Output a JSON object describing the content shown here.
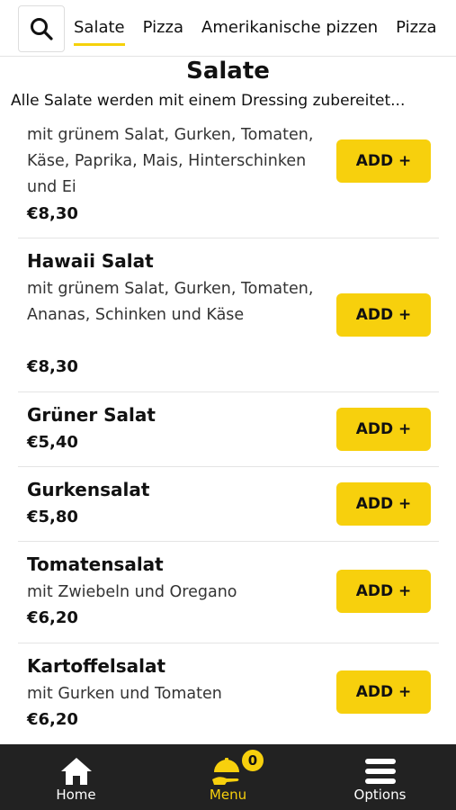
{
  "header": {
    "tabs": [
      {
        "label": "Salate"
      },
      {
        "label": "Pizza"
      },
      {
        "label": "Amerikanische pizzen"
      },
      {
        "label": "Pizza"
      }
    ]
  },
  "category": {
    "title": "Salate",
    "description": "Alle Salate werden mit einem Dressing zubereitet..."
  },
  "items": [
    {
      "name": "",
      "desc": "mit grünem Salat, Gurken, Tomaten, Käse, Paprika, Mais, Hinterschinken und Ei",
      "price": "€8,30",
      "button": "ADD +"
    },
    {
      "name": "Hawaii Salat",
      "desc": "mit grünem Salat, Gurken, Tomaten, Ananas, Schinken und Käse",
      "price": "€8,30",
      "button": "ADD +"
    },
    {
      "name": "Grüner Salat",
      "desc": "",
      "price": "€5,40",
      "button": "ADD +"
    },
    {
      "name": "Gurkensalat",
      "desc": "",
      "price": "€5,80",
      "button": "ADD +"
    },
    {
      "name": "Tomatensalat",
      "desc": "mit Zwiebeln und Oregano",
      "price": "€6,20",
      "button": "ADD +"
    },
    {
      "name": "Kartoffelsalat",
      "desc": "mit Gurken und Tomaten",
      "price": "€6,20",
      "button": "ADD +"
    }
  ],
  "nav": {
    "home": "Home",
    "menu": "Menu",
    "options": "Options",
    "cart_count": "0"
  },
  "colors": {
    "accent": "#f7d00d",
    "nav_bg": "#222222"
  }
}
